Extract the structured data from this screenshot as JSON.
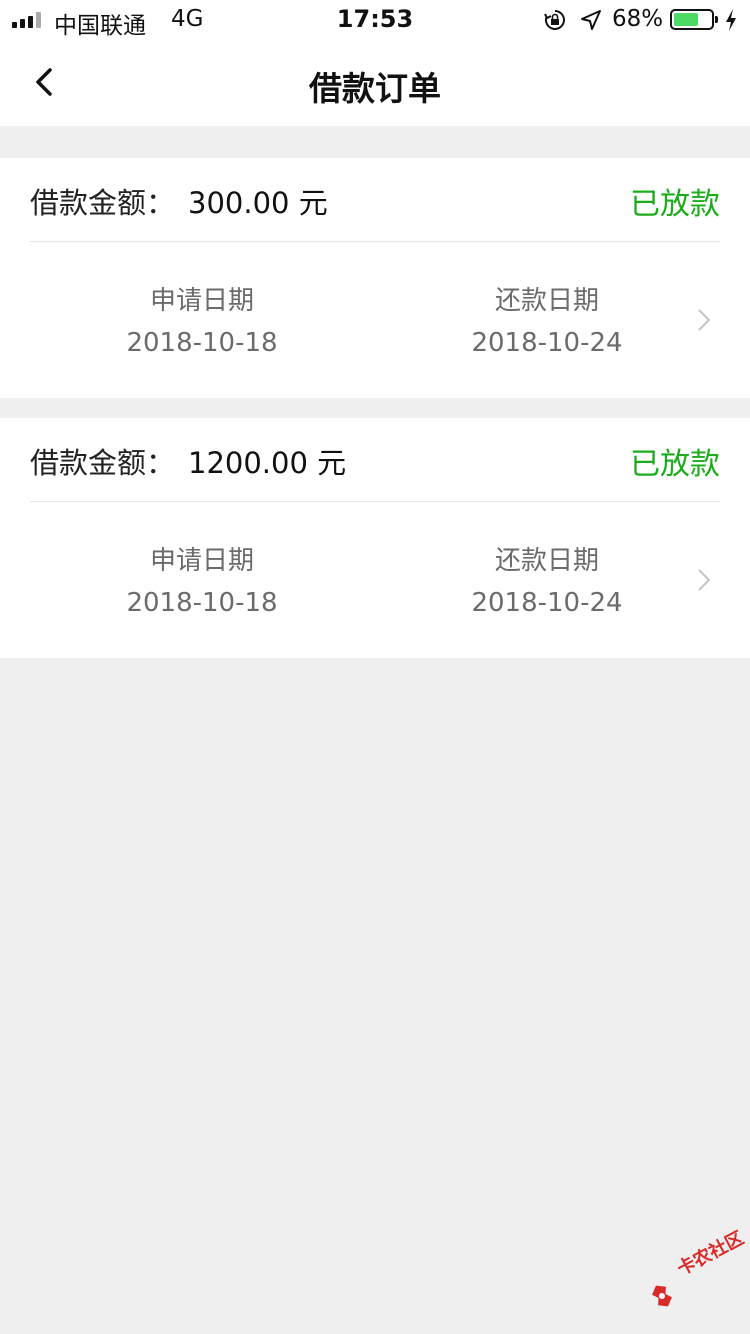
{
  "status_bar": {
    "carrier": "中国联通",
    "network": "4G",
    "time": "17:53",
    "battery_percent": "68%",
    "battery_level": 0.68,
    "icons": [
      "signal-bars-icon",
      "orientation-lock-icon",
      "location-arrow-icon",
      "battery-icon",
      "charging-bolt-icon"
    ]
  },
  "nav": {
    "title": "借款订单",
    "back_icon": "chevron-left-icon"
  },
  "orders": [
    {
      "amount_label": "借款金额：",
      "amount_value": "300.00 元",
      "status": "已放款",
      "apply_label": "申请日期",
      "apply_date": "2018-10-18",
      "repay_label": "还款日期",
      "repay_date": "2018-10-24"
    },
    {
      "amount_label": "借款金额：",
      "amount_value": "1200.00 元",
      "status": "已放款",
      "apply_label": "申请日期",
      "apply_date": "2018-10-18",
      "repay_label": "还款日期",
      "repay_date": "2018-10-24"
    }
  ],
  "colors": {
    "status_green": "#1aad19",
    "background": "#efefef",
    "battery_green": "#4cd964"
  },
  "watermark": {
    "text": "卡农社区"
  }
}
